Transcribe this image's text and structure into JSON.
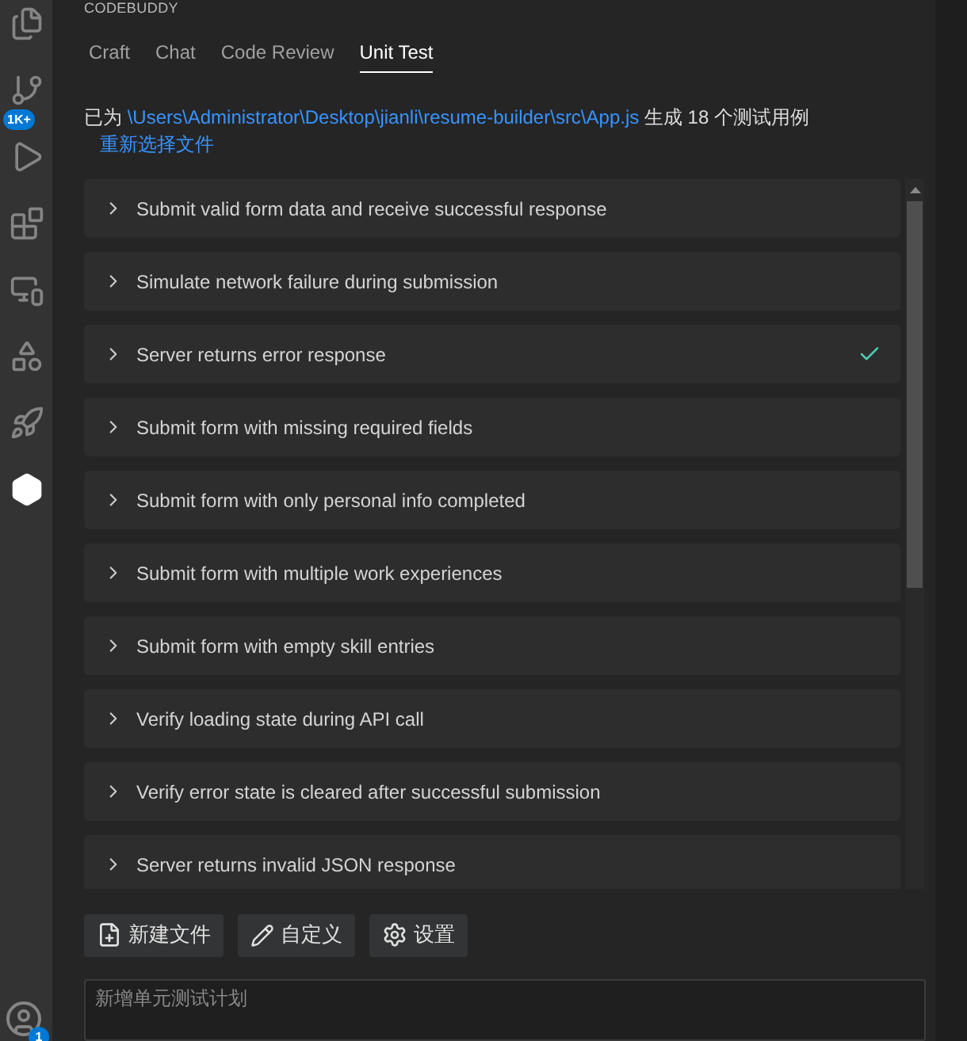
{
  "panel_title": "CODEBUDDY",
  "activity_bar": {
    "source_control_badge": "1K+",
    "account_badge": "1"
  },
  "tabs": [
    {
      "label": "Craft",
      "selected": false
    },
    {
      "label": "Chat",
      "selected": false
    },
    {
      "label": "Code Review",
      "selected": false
    },
    {
      "label": "Unit Test",
      "selected": true
    }
  ],
  "status": {
    "prefix": "已为",
    "file_path": "\\Users\\Administrator\\Desktop\\jianli\\resume-builder\\src\\App.js",
    "suffix": "生成 18 个测试用例",
    "reselect_link": "重新选择文件"
  },
  "tests": [
    {
      "name": "Submit valid form data and receive successful response",
      "passed": false
    },
    {
      "name": "Simulate network failure during submission",
      "passed": false
    },
    {
      "name": "Server returns error response",
      "passed": true
    },
    {
      "name": "Submit form with missing required fields",
      "passed": false
    },
    {
      "name": "Submit form with only personal info completed",
      "passed": false
    },
    {
      "name": "Submit form with multiple work experiences",
      "passed": false
    },
    {
      "name": "Submit form with empty skill entries",
      "passed": false
    },
    {
      "name": "Verify loading state during API call",
      "passed": false
    },
    {
      "name": "Verify error state is cleared after successful submission",
      "passed": false
    },
    {
      "name": "Server returns invalid JSON response",
      "passed": false
    }
  ],
  "buttons": [
    {
      "kind": "new-file",
      "label": "新建文件"
    },
    {
      "kind": "customize",
      "label": "自定义"
    },
    {
      "kind": "settings",
      "label": "设置"
    }
  ],
  "input": {
    "placeholder": "新增单元测试计划"
  }
}
